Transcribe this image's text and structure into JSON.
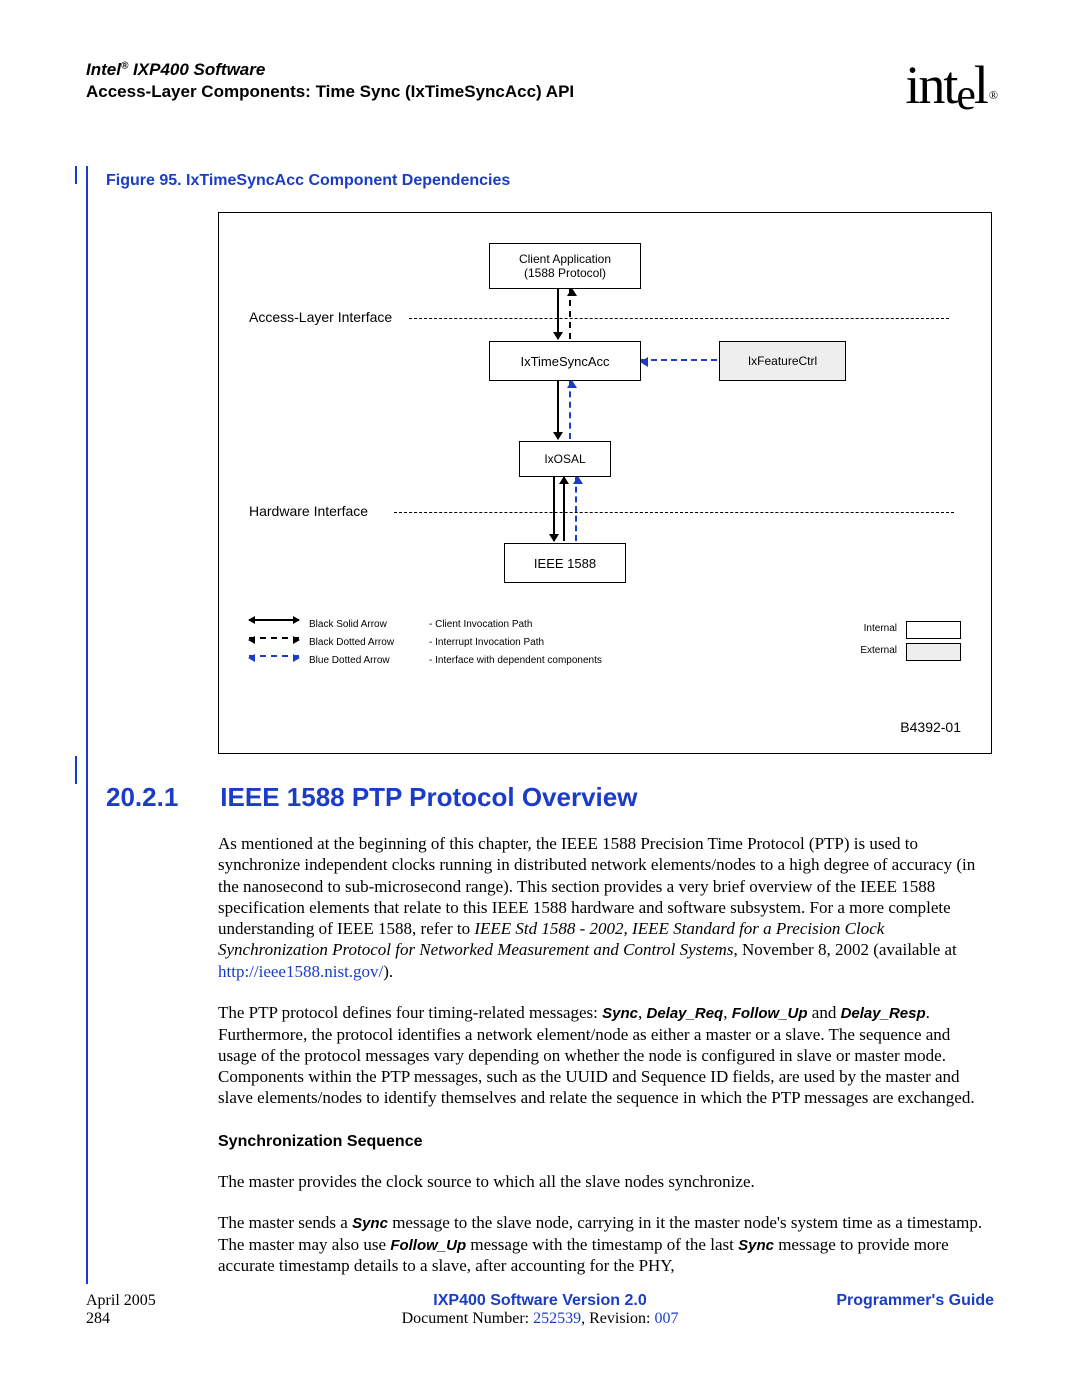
{
  "header": {
    "product": "Intel",
    "reg": "®",
    "product_suffix": " IXP400 Software",
    "chapter": "Access-Layer Components: Time Sync (IxTimeSyncAcc) API",
    "logo": {
      "prefix": "int",
      "sub": "e",
      "suffix": "l",
      "reg": "®"
    }
  },
  "figure": {
    "caption": "Figure 95. IxTimeSyncAcc Component Dependencies"
  },
  "diagram": {
    "client_l1": "Client Application",
    "client_l2": "(1588 Protocol)",
    "sync": "IxTimeSyncAcc",
    "feat": "IxFeatureCtrl",
    "osal": "IxOSAL",
    "ieee": "IEEE 1588",
    "al_label": "Access-Layer Interface",
    "hw_label": "Hardware Interface",
    "legend": {
      "r1a": "Black Solid Arrow",
      "r1b": "- Client Invocation Path",
      "r2a": "Black Dotted Arrow",
      "r2b": "- Interrupt Invocation Path",
      "r3a": "Blue Dotted Arrow",
      "r3b": "- Interface with dependent components",
      "internal": "Internal",
      "external": "External"
    },
    "code": "B4392-01"
  },
  "section": {
    "number": "20.2.1",
    "title": "IEEE 1588 PTP Protocol Overview"
  },
  "para1": {
    "t1": "As mentioned at the beginning of this chapter, the IEEE 1588 Precision Time Protocol (PTP) is used to synchronize independent clocks running in distributed network elements/nodes to a high degree of accuracy (in the nanosecond to sub-microsecond range). This section provides a very brief overview of the IEEE 1588 specification elements that relate to this IEEE 1588 hardware and software subsystem. For a more complete understanding of IEEE 1588, refer to ",
    "ital": "IEEE Std 1588 - 2002, IEEE Standard for a Precision Clock Synchronization Protocol for Networked Measurement and Control Systems",
    "t2": ", November 8, 2002 (available at ",
    "link": "http://ieee1588.nist.gov/",
    "t3": ")."
  },
  "para2": {
    "t1": "The PTP protocol defines four timing-related messages: ",
    "m1": "Sync",
    "c1": ", ",
    "m2": "Delay_Req",
    "c2": ", ",
    "m3": "Follow_Up",
    "c3": " and ",
    "m4": "Delay_Resp",
    "t2": ". Furthermore, the protocol identifies a network element/node as either a master or a slave. The sequence and usage of the protocol messages vary depending on whether the node is configured in slave or master mode. Components within the PTP messages, such as the UUID and Sequence ID fields, are used by the master and slave elements/nodes to identify themselves and relate the sequence in which the PTP messages are exchanged."
  },
  "sub1": "Synchronization Sequence",
  "para3": "The master provides the clock source to which all the slave nodes synchronize.",
  "para4": {
    "t1": "The master sends a ",
    "m1": "Sync",
    "t2": " message to the slave node, carrying in it the master node's system time as a timestamp. The master may also use ",
    "m2": "Follow_Up",
    "t3": " message with the timestamp of the last ",
    "m3": "Sync",
    "t4": " message to provide more accurate timestamp details to a slave, after accounting for the PHY,"
  },
  "footer": {
    "date": "April 2005",
    "page": "284",
    "center_bold": "IXP400 Software Version 2.0",
    "docnum_label": "Document Number: ",
    "docnum": "252539",
    "rev_label": ", Revision: ",
    "rev": "007",
    "right": "Programmer's Guide"
  }
}
